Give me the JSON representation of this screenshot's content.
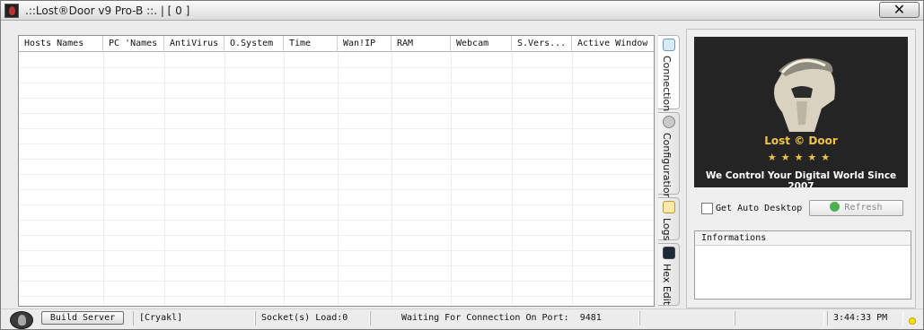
{
  "window": {
    "title": ".::Lost®Door v9 Pro-B ::. | [ 0 ]",
    "close_label": "✕"
  },
  "connections_list": {
    "columns": [
      "Hosts Names",
      "PC 'Names",
      "AntiVirus",
      "O.System",
      "Time",
      "Wan!IP",
      "RAM",
      "Webcam",
      "S.Vers...",
      "Active Window"
    ],
    "rows": []
  },
  "tabs": [
    {
      "label": "Connections",
      "icon": "connections-icon",
      "active": true
    },
    {
      "label": "Configuration",
      "icon": "gear-icon",
      "active": false
    },
    {
      "label": "Logs",
      "icon": "logs-icon",
      "active": false
    },
    {
      "label": "Hex Edit",
      "icon": "terminal-icon",
      "active": false
    }
  ],
  "banner": {
    "brand_name": "Lost © Door",
    "stars": "★★★★★",
    "tagline": "We Control Your Digital World Since 2007",
    "logo": "spartan-helmet-logo"
  },
  "auto_desktop": {
    "label": "Get Auto Desktop",
    "checked": false
  },
  "refresh": {
    "label": "Refresh",
    "enabled": false
  },
  "informations": {
    "header": "Informations"
  },
  "statusbar": {
    "build_label": "Build Server",
    "user": "[Cryakl]",
    "socket_load": "Socket(s) Load:0",
    "waiting": "Waiting For Connection On Port:",
    "port": "9481",
    "time": "3:44:33 PM",
    "indicator_color": "#ffe100"
  }
}
